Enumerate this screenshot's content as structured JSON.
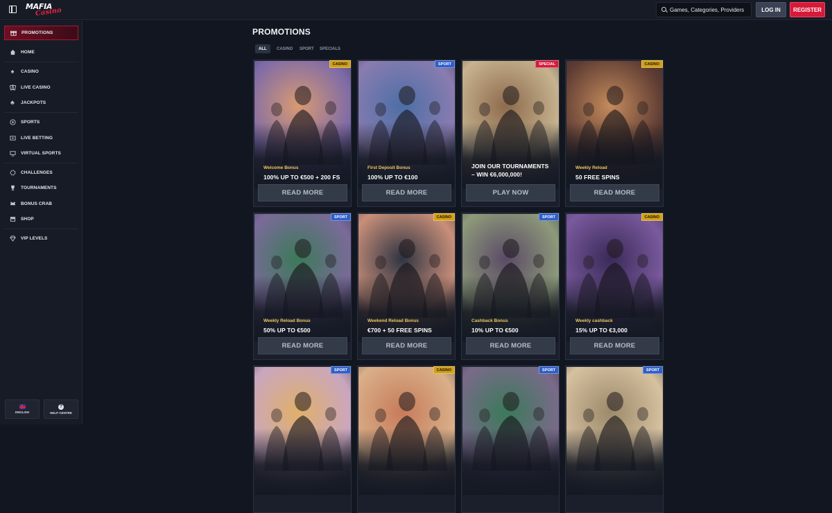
{
  "brand": {
    "logo_word1": "MAFIA",
    "logo_word2": "Casino"
  },
  "header": {
    "search_placeholder": "Games, Categories, Providers",
    "login_label": "LOG IN",
    "register_label": "REGISTER"
  },
  "sidebar": {
    "items": [
      {
        "label": "PROMOTIONS",
        "icon": "gift-icon"
      },
      {
        "label": "HOME",
        "icon": "home-icon"
      },
      {
        "label": "CASINO",
        "icon": "spade-icon"
      },
      {
        "label": "LIVE CASINO",
        "icon": "cards-icon"
      },
      {
        "label": "JACKPOTS",
        "icon": "clover-icon"
      },
      {
        "label": "SPORTS",
        "icon": "ball-icon"
      },
      {
        "label": "LIVE BETTING",
        "icon": "live-betting-icon"
      },
      {
        "label": "VIRTUAL SPORTS",
        "icon": "virtual-sports-icon"
      },
      {
        "label": "CHALLENGES",
        "icon": "challenges-icon"
      },
      {
        "label": "TOURNAMENTS",
        "icon": "trophy-icon"
      },
      {
        "label": "BONUS CRAB",
        "icon": "crab-icon"
      },
      {
        "label": "SHOP",
        "icon": "shop-icon"
      },
      {
        "label": "VIP LEVELS",
        "icon": "diamond-icon"
      }
    ],
    "language_label": "ENGLISH",
    "help_label": "HELP CENTRE"
  },
  "main": {
    "title": "PROMOTIONS",
    "filters": [
      "ALL",
      "CASINO",
      "SPORT",
      "SPECIALS"
    ],
    "cards": [
      {
        "badge": "CASINO",
        "subtitle": "Welcome Bonus",
        "headline": "100% UP TO €500 + 200 FS",
        "cta": "READ MORE",
        "palette": [
          "#7d6aa8",
          "#d89a72"
        ]
      },
      {
        "badge": "SPORT",
        "subtitle": "First Deposit Bonus",
        "headline": "100% UP TO €100",
        "cta": "READ MORE",
        "palette": [
          "#8a7cb0",
          "#4c6fa6"
        ]
      },
      {
        "badge": "SPECIAL",
        "subtitle": "",
        "headline": "JOIN OUR TOURNAMENTS – WIN €6,000,000!",
        "cta": "PLAY NOW",
        "palette": [
          "#c7b38f",
          "#8d6b4d"
        ]
      },
      {
        "badge": "CASINO",
        "subtitle": "Weekly Reload",
        "headline": "50 FREE SPINS",
        "cta": "READ MORE",
        "palette": [
          "#5b3a32",
          "#c58b5c"
        ]
      },
      {
        "badge": "SPORT",
        "subtitle": "Weekly Reload Bonus",
        "headline": "50% UP TO €500",
        "cta": "READ MORE",
        "palette": [
          "#7b6a9a",
          "#3b7a58"
        ]
      },
      {
        "badge": "CASINO",
        "subtitle": "Weekend Reload Bonus",
        "headline": "€700 + 50 FREE SPINS",
        "cta": "READ MORE",
        "palette": [
          "#c98f7a",
          "#2f3442"
        ]
      },
      {
        "badge": "SPORT",
        "subtitle": "Cashback Bonus",
        "headline": "10% UP TO €500",
        "cta": "READ MORE",
        "palette": [
          "#8e9a7a",
          "#5a4a66"
        ]
      },
      {
        "badge": "CASINO",
        "subtitle": "Weekly cashback",
        "headline": "15% UP TO €3,000",
        "cta": "READ MORE",
        "palette": [
          "#7a5a9e",
          "#3a2a58"
        ]
      },
      {
        "badge": "SPORT",
        "subtitle": "",
        "headline": "",
        "cta": "",
        "palette": [
          "#c9a6c0",
          "#e0b06a"
        ]
      },
      {
        "badge": "CASINO",
        "subtitle": "",
        "headline": "",
        "cta": "",
        "palette": [
          "#d9b08a",
          "#c77b5a"
        ]
      },
      {
        "badge": "SPORT",
        "subtitle": "",
        "headline": "",
        "cta": "",
        "palette": [
          "#7a6a8a",
          "#3a7a5a"
        ]
      },
      {
        "badge": "SPORT",
        "subtitle": "",
        "headline": "",
        "cta": "",
        "palette": [
          "#d6c1a0",
          "#9c8a6a"
        ]
      }
    ]
  },
  "colors": {
    "accent": "#d61a3a",
    "casino_badge": "#d2a015",
    "sport_badge": "#2f5fc8",
    "special_badge": "#d41b3b"
  }
}
